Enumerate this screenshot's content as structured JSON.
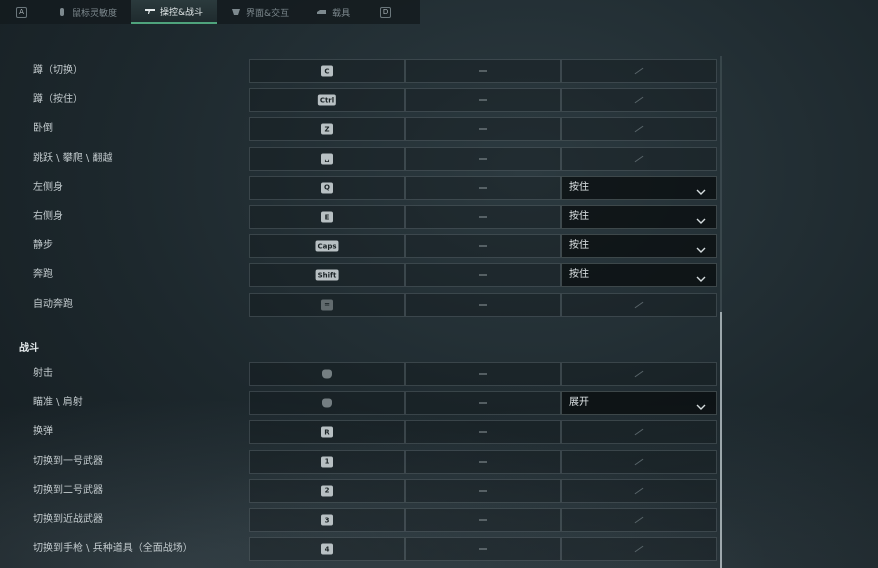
{
  "tabs": {
    "left_hint": "A",
    "right_hint": "D",
    "items": [
      {
        "label": "鼠标灵敏度",
        "icon": "mouse-icon"
      },
      {
        "label": "操控&战斗",
        "icon": "rifle-icon",
        "active": true
      },
      {
        "label": "界面&交互",
        "icon": "interface-icon"
      },
      {
        "label": "载具",
        "icon": "vehicle-icon"
      }
    ]
  },
  "movement_rows": [
    {
      "label": "蹲（切换）",
      "key": "C",
      "mode": ""
    },
    {
      "label": "蹲（按住）",
      "key": "Ctrl",
      "mode": ""
    },
    {
      "label": "卧倒",
      "key": "Z",
      "mode": ""
    },
    {
      "label": "跳跃 \\ 攀爬 \\ 翻越",
      "key": "␣",
      "mode": ""
    },
    {
      "label": "左侧身",
      "key": "Q",
      "mode": "按住"
    },
    {
      "label": "右侧身",
      "key": "E",
      "mode": "按住"
    },
    {
      "label": "静步",
      "key": "Caps",
      "mode": "按住"
    },
    {
      "label": "奔跑",
      "key": "Shift",
      "mode": "按住"
    },
    {
      "label": "自动奔跑",
      "key": "=",
      "mode": ""
    }
  ],
  "combat_section": {
    "title": "战斗",
    "rows": [
      {
        "label": "射击",
        "key": "mouse-left",
        "mode": ""
      },
      {
        "label": "瞄准 \\ 肩射",
        "key": "mouse-right",
        "mode": "展开"
      },
      {
        "label": "换弹",
        "key": "R",
        "mode": ""
      },
      {
        "label": "切换到一号武器",
        "key": "1",
        "mode": ""
      },
      {
        "label": "切换到二号武器",
        "key": "2",
        "mode": ""
      },
      {
        "label": "切换到近战武器",
        "key": "3",
        "mode": ""
      },
      {
        "label": "切换到手枪 \\ 兵种道具（全面战场）",
        "key": "4",
        "mode": ""
      }
    ]
  },
  "secondary_binding": "—",
  "colors": {
    "accent": "#4fa37c",
    "keycap": "#b8c0c3",
    "background": "#1d282d"
  }
}
